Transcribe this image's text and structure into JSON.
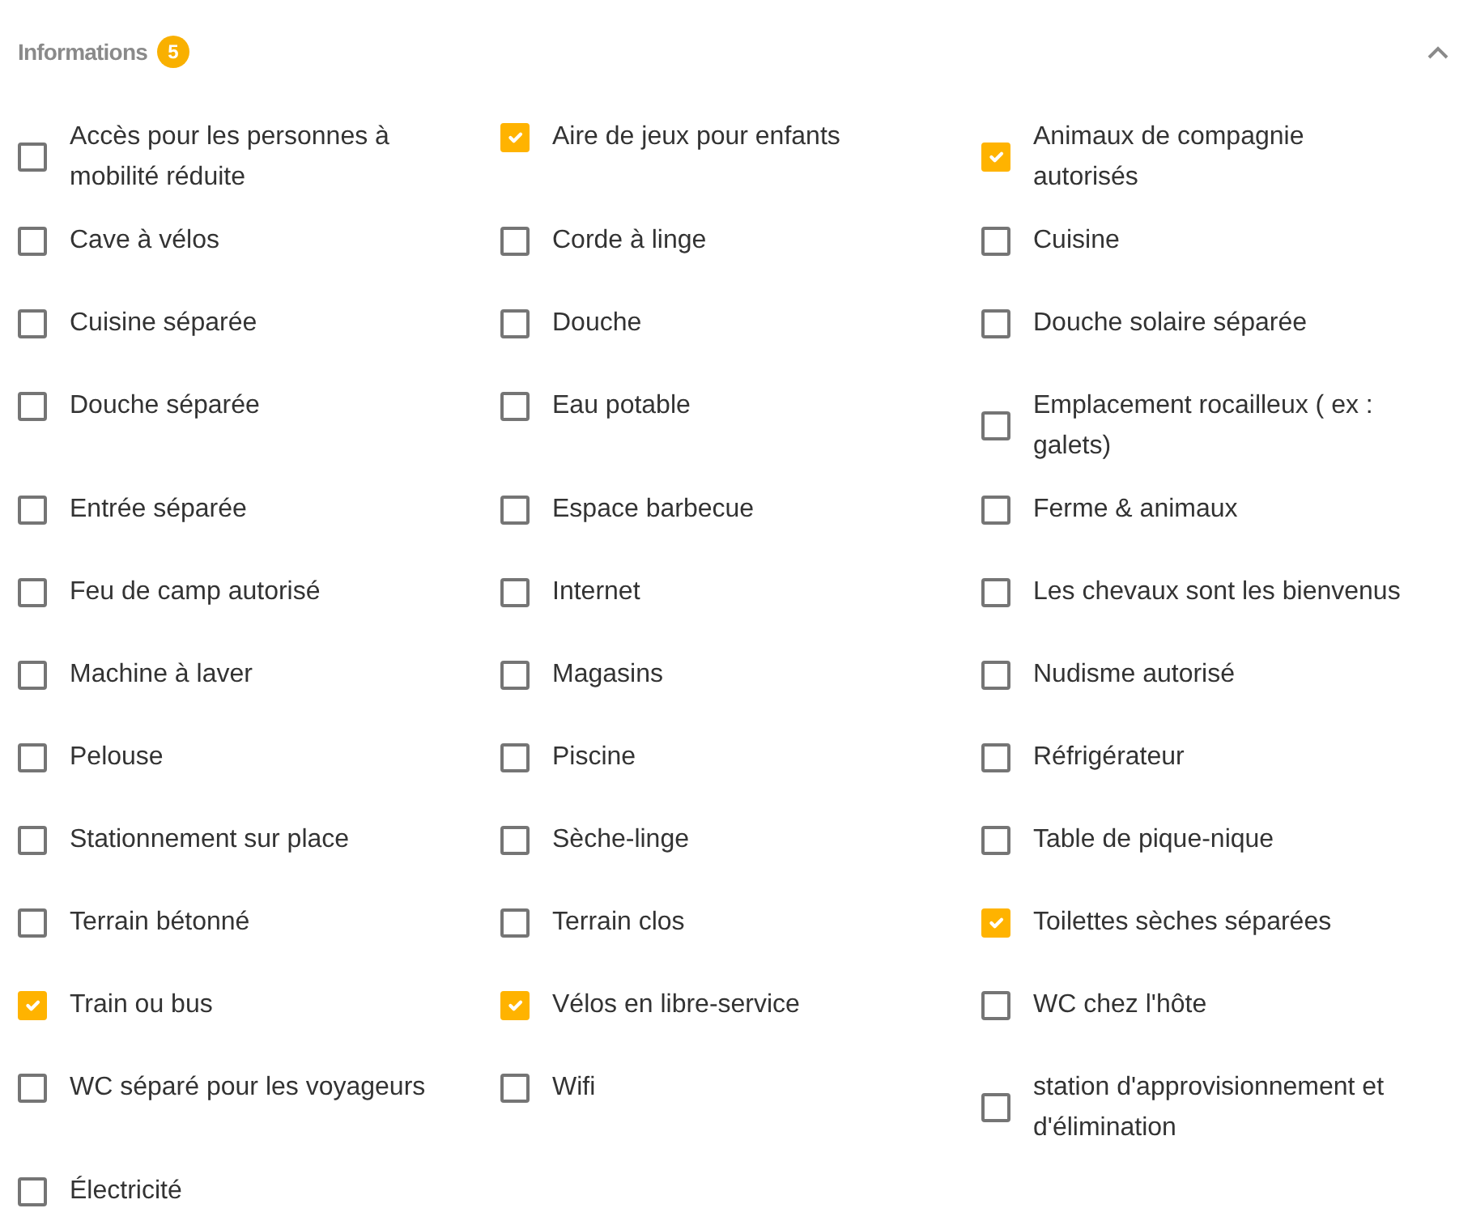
{
  "section": {
    "title": "Informations",
    "badge": "5",
    "expanded": true
  },
  "amenities": [
    {
      "label": "Accès pour les personnes à mobilité réduite",
      "checked": false
    },
    {
      "label": "Aire de jeux pour enfants",
      "checked": true
    },
    {
      "label": "Animaux de compagnie autorisés",
      "checked": true
    },
    {
      "label": "Cave à vélos",
      "checked": false
    },
    {
      "label": "Corde à linge",
      "checked": false
    },
    {
      "label": "Cuisine",
      "checked": false
    },
    {
      "label": "Cuisine séparée",
      "checked": false
    },
    {
      "label": "Douche",
      "checked": false
    },
    {
      "label": "Douche solaire séparée",
      "checked": false
    },
    {
      "label": "Douche séparée",
      "checked": false
    },
    {
      "label": "Eau potable",
      "checked": false
    },
    {
      "label": "Emplacement rocailleux ( ex : galets)",
      "checked": false
    },
    {
      "label": "Entrée séparée",
      "checked": false
    },
    {
      "label": "Espace barbecue",
      "checked": false
    },
    {
      "label": "Ferme & animaux",
      "checked": false
    },
    {
      "label": "Feu de camp autorisé",
      "checked": false
    },
    {
      "label": "Internet",
      "checked": false
    },
    {
      "label": "Les chevaux sont les bienvenus",
      "checked": false
    },
    {
      "label": "Machine à laver",
      "checked": false
    },
    {
      "label": "Magasins",
      "checked": false
    },
    {
      "label": "Nudisme autorisé",
      "checked": false
    },
    {
      "label": "Pelouse",
      "checked": false
    },
    {
      "label": "Piscine",
      "checked": false
    },
    {
      "label": "Réfrigérateur",
      "checked": false
    },
    {
      "label": "Stationnement sur place",
      "checked": false
    },
    {
      "label": "Sèche-linge",
      "checked": false
    },
    {
      "label": "Table de pique-nique",
      "checked": false
    },
    {
      "label": "Terrain bétonné",
      "checked": false
    },
    {
      "label": "Terrain clos",
      "checked": false
    },
    {
      "label": "Toilettes sèches séparées",
      "checked": true
    },
    {
      "label": "Train ou bus",
      "checked": true
    },
    {
      "label": "Vélos en libre-service",
      "checked": true
    },
    {
      "label": "WC chez l'hôte",
      "checked": false
    },
    {
      "label": "WC séparé pour les voyageurs",
      "checked": false
    },
    {
      "label": "Wifi",
      "checked": false
    },
    {
      "label": "station d'approvisionnement et d'élimination",
      "checked": false
    },
    {
      "label": "Électricité",
      "checked": false
    }
  ]
}
